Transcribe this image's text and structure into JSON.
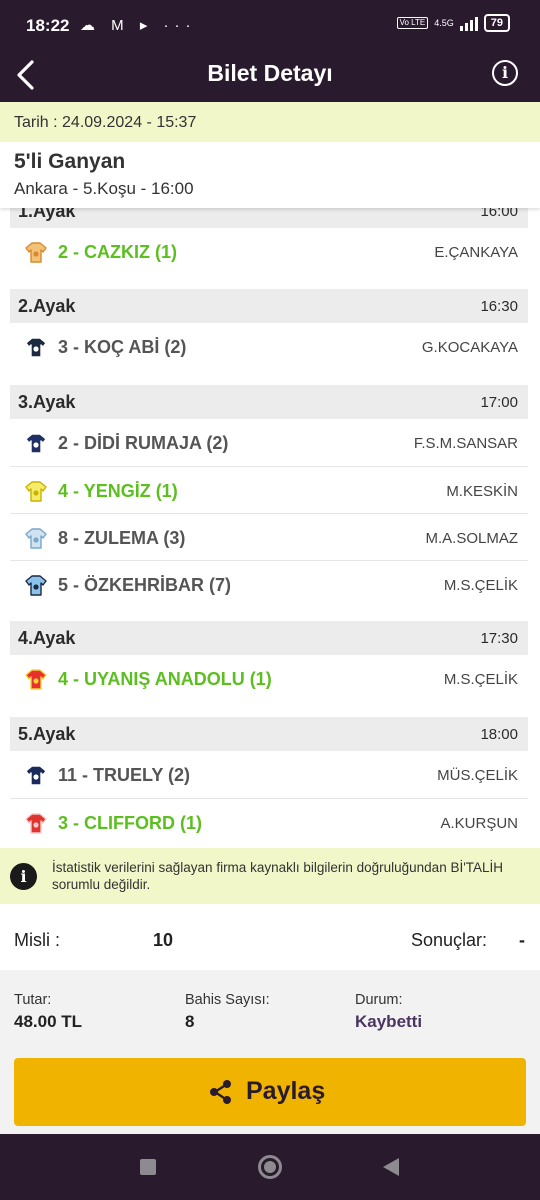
{
  "status_bar": {
    "time": "18:22",
    "left_icons": "☁ M ▸ ···",
    "volte": "Vo LTE",
    "network": "4.5G",
    "battery": "79"
  },
  "header": {
    "title": "Bilet Detayı"
  },
  "date_line": "Tarih : 24.09.2024 - 15:37",
  "bet": {
    "type": "5'li Ganyan",
    "race": "Ankara - 5.Koşu - 16:00"
  },
  "legs": [
    {
      "label": "1.Ayak",
      "time": "16:00",
      "runners": [
        {
          "horse": "2 - CAZKIZ (1)",
          "jockey": "E.ÇANKAYA",
          "winner": true,
          "silk": [
            "#f2c27a",
            "#d98a2b"
          ]
        }
      ]
    },
    {
      "label": "2.Ayak",
      "time": "16:30",
      "runners": [
        {
          "horse": "3 - KOÇ ABİ (2)",
          "jockey": "G.KOCAKAYA",
          "winner": false,
          "silk": [
            "#1b2a40",
            "#ffffff"
          ]
        }
      ]
    },
    {
      "label": "3.Ayak",
      "time": "17:00",
      "runners": [
        {
          "horse": "2 - DİDİ RUMAJA (2)",
          "jockey": "F.S.M.SANSAR",
          "winner": false,
          "silk": [
            "#1f2f66",
            "#ffffff"
          ]
        },
        {
          "horse": "4 - YENGİZ (1)",
          "jockey": "M.KESKİN",
          "winner": true,
          "silk": [
            "#f5ec6a",
            "#c9b400"
          ]
        },
        {
          "horse": "8 - ZULEMA (3)",
          "jockey": "M.A.SOLMAZ",
          "winner": false,
          "silk": [
            "#cfe3f2",
            "#7aa7cc"
          ]
        },
        {
          "horse": "5 - ÖZKEHRİBAR (7)",
          "jockey": "M.S.ÇELİK",
          "winner": false,
          "silk": [
            "#8cc3e8",
            "#1a2a4a"
          ]
        }
      ]
    },
    {
      "label": "4.Ayak",
      "time": "17:30",
      "runners": [
        {
          "horse": "4 - UYANIŞ ANADOLU (1)",
          "jockey": "M.S.ÇELİK",
          "winner": true,
          "silk": [
            "#e8312f",
            "#f5d23a"
          ]
        }
      ]
    },
    {
      "label": "5.Ayak",
      "time": "18:00",
      "runners": [
        {
          "horse": "11 - TRUELY (2)",
          "jockey": "MÜS.ÇELİK",
          "winner": false,
          "silk": [
            "#1b2a5a",
            "#ffffff"
          ]
        },
        {
          "horse": "3 - CLIFFORD (1)",
          "jockey": "A.KURŞUN",
          "winner": true,
          "silk": [
            "#e0342f",
            "#f6c9c9"
          ]
        }
      ]
    }
  ],
  "notice": "İstatistik verilerini sağlayan firma kaynaklı bilgilerin doğruluğundan Bİ'TALİH sorumlu değildir.",
  "misli": {
    "label": "Misli :",
    "value": "10"
  },
  "sonuclar": {
    "label": "Sonuçlar:",
    "value": "-"
  },
  "summary": {
    "tutar_label": "Tutar:",
    "tutar_value": "48.00 TL",
    "bahis_label": "Bahis Sayısı:",
    "bahis_value": "8",
    "durum_label": "Durum:",
    "durum_value": "Kaybetti"
  },
  "share_label": "Paylaş",
  "colors": {
    "header_bg": "#2a1a2e",
    "highlight_bg": "#f1f7c9",
    "winner_green": "#5cbf1f",
    "share_yellow": "#f0b400",
    "lost_purple": "#4a3560"
  }
}
